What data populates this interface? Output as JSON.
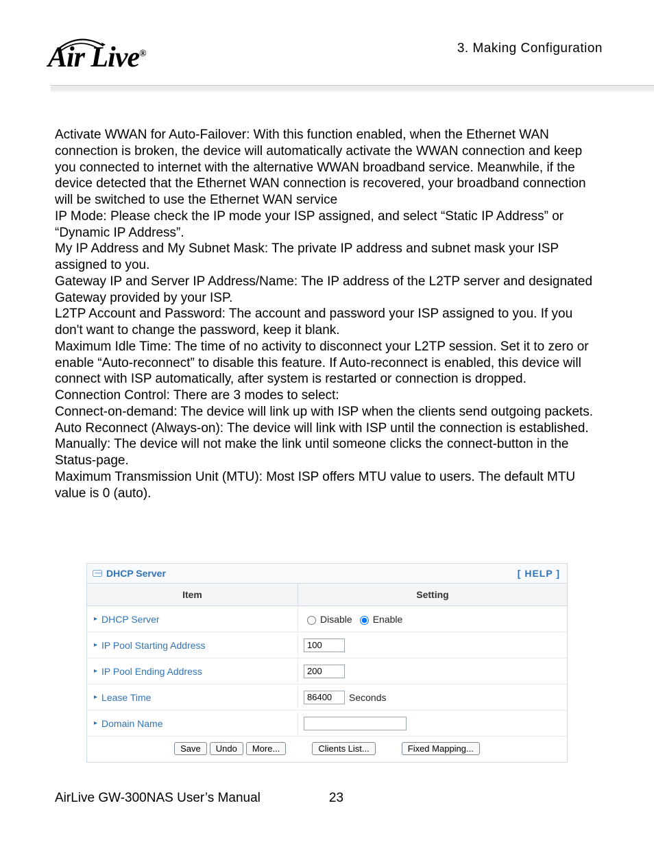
{
  "header": {
    "chapter": "3.  Making  Configuration",
    "logo_a": "A",
    "logo_ir": "ir",
    "logo_live": " Live",
    "logo_reg": "®"
  },
  "body_text": "Activate WWAN for Auto-Failover: With this function enabled, when the Ethernet WAN connection is broken, the device will automatically activate the WWAN connection and keep you connected to internet with the alternative WWAN broadband service. Meanwhile, if the device detected that the Ethernet WAN connection is recovered, your broadband connection will be switched to use the Ethernet WAN service\nIP Mode: Please check the IP mode your ISP assigned, and select “Static IP Address” or “Dynamic IP Address”.\nMy IP Address and My Subnet Mask: The private IP address and subnet mask your ISP assigned to you.\nGateway IP and Server IP Address/Name: The IP address of the L2TP server and designated Gateway provided by your ISP.\nL2TP Account and Password: The account and password your ISP assigned to you. If you don't want to change the password, keep it blank.\nMaximum Idle Time: The time of no activity to disconnect your L2TP session. Set it to zero or enable “Auto-reconnect” to disable this feature. If Auto-reconnect is enabled, this device will connect with ISP automatically, after system is restarted or connection is dropped.\nConnection Control: There are 3 modes to select:\nConnect-on-demand: The device will link up with ISP when the clients send outgoing packets.\nAuto Reconnect (Always-on): The device will link with ISP until the connection is established.\nManually: The device will not make the link until someone clicks the connect-button in the Status-page.\nMaximum Transmission Unit (MTU): Most ISP offers MTU value to users. The default MTU value is 0 (auto).",
  "panel": {
    "title": "DHCP Server",
    "help": "[ HELP ]",
    "columns": {
      "item": "Item",
      "setting": "Setting"
    },
    "rows": {
      "dhcp_server": {
        "label": "DHCP Server",
        "disable": "Disable",
        "enable": "Enable",
        "selected": "enable"
      },
      "ip_start": {
        "label": "IP Pool Starting Address",
        "value": "100"
      },
      "ip_end": {
        "label": "IP Pool Ending Address",
        "value": "200"
      },
      "lease": {
        "label": "Lease Time",
        "value": "86400",
        "unit": "Seconds"
      },
      "domain": {
        "label": "Domain Name",
        "value": ""
      }
    },
    "buttons": {
      "save": "Save",
      "undo": "Undo",
      "more": "More...",
      "clients": "Clients List...",
      "fixed": "Fixed Mapping..."
    }
  },
  "footer": {
    "manual": "AirLive GW-300NAS User’s Manual",
    "page": "23"
  }
}
